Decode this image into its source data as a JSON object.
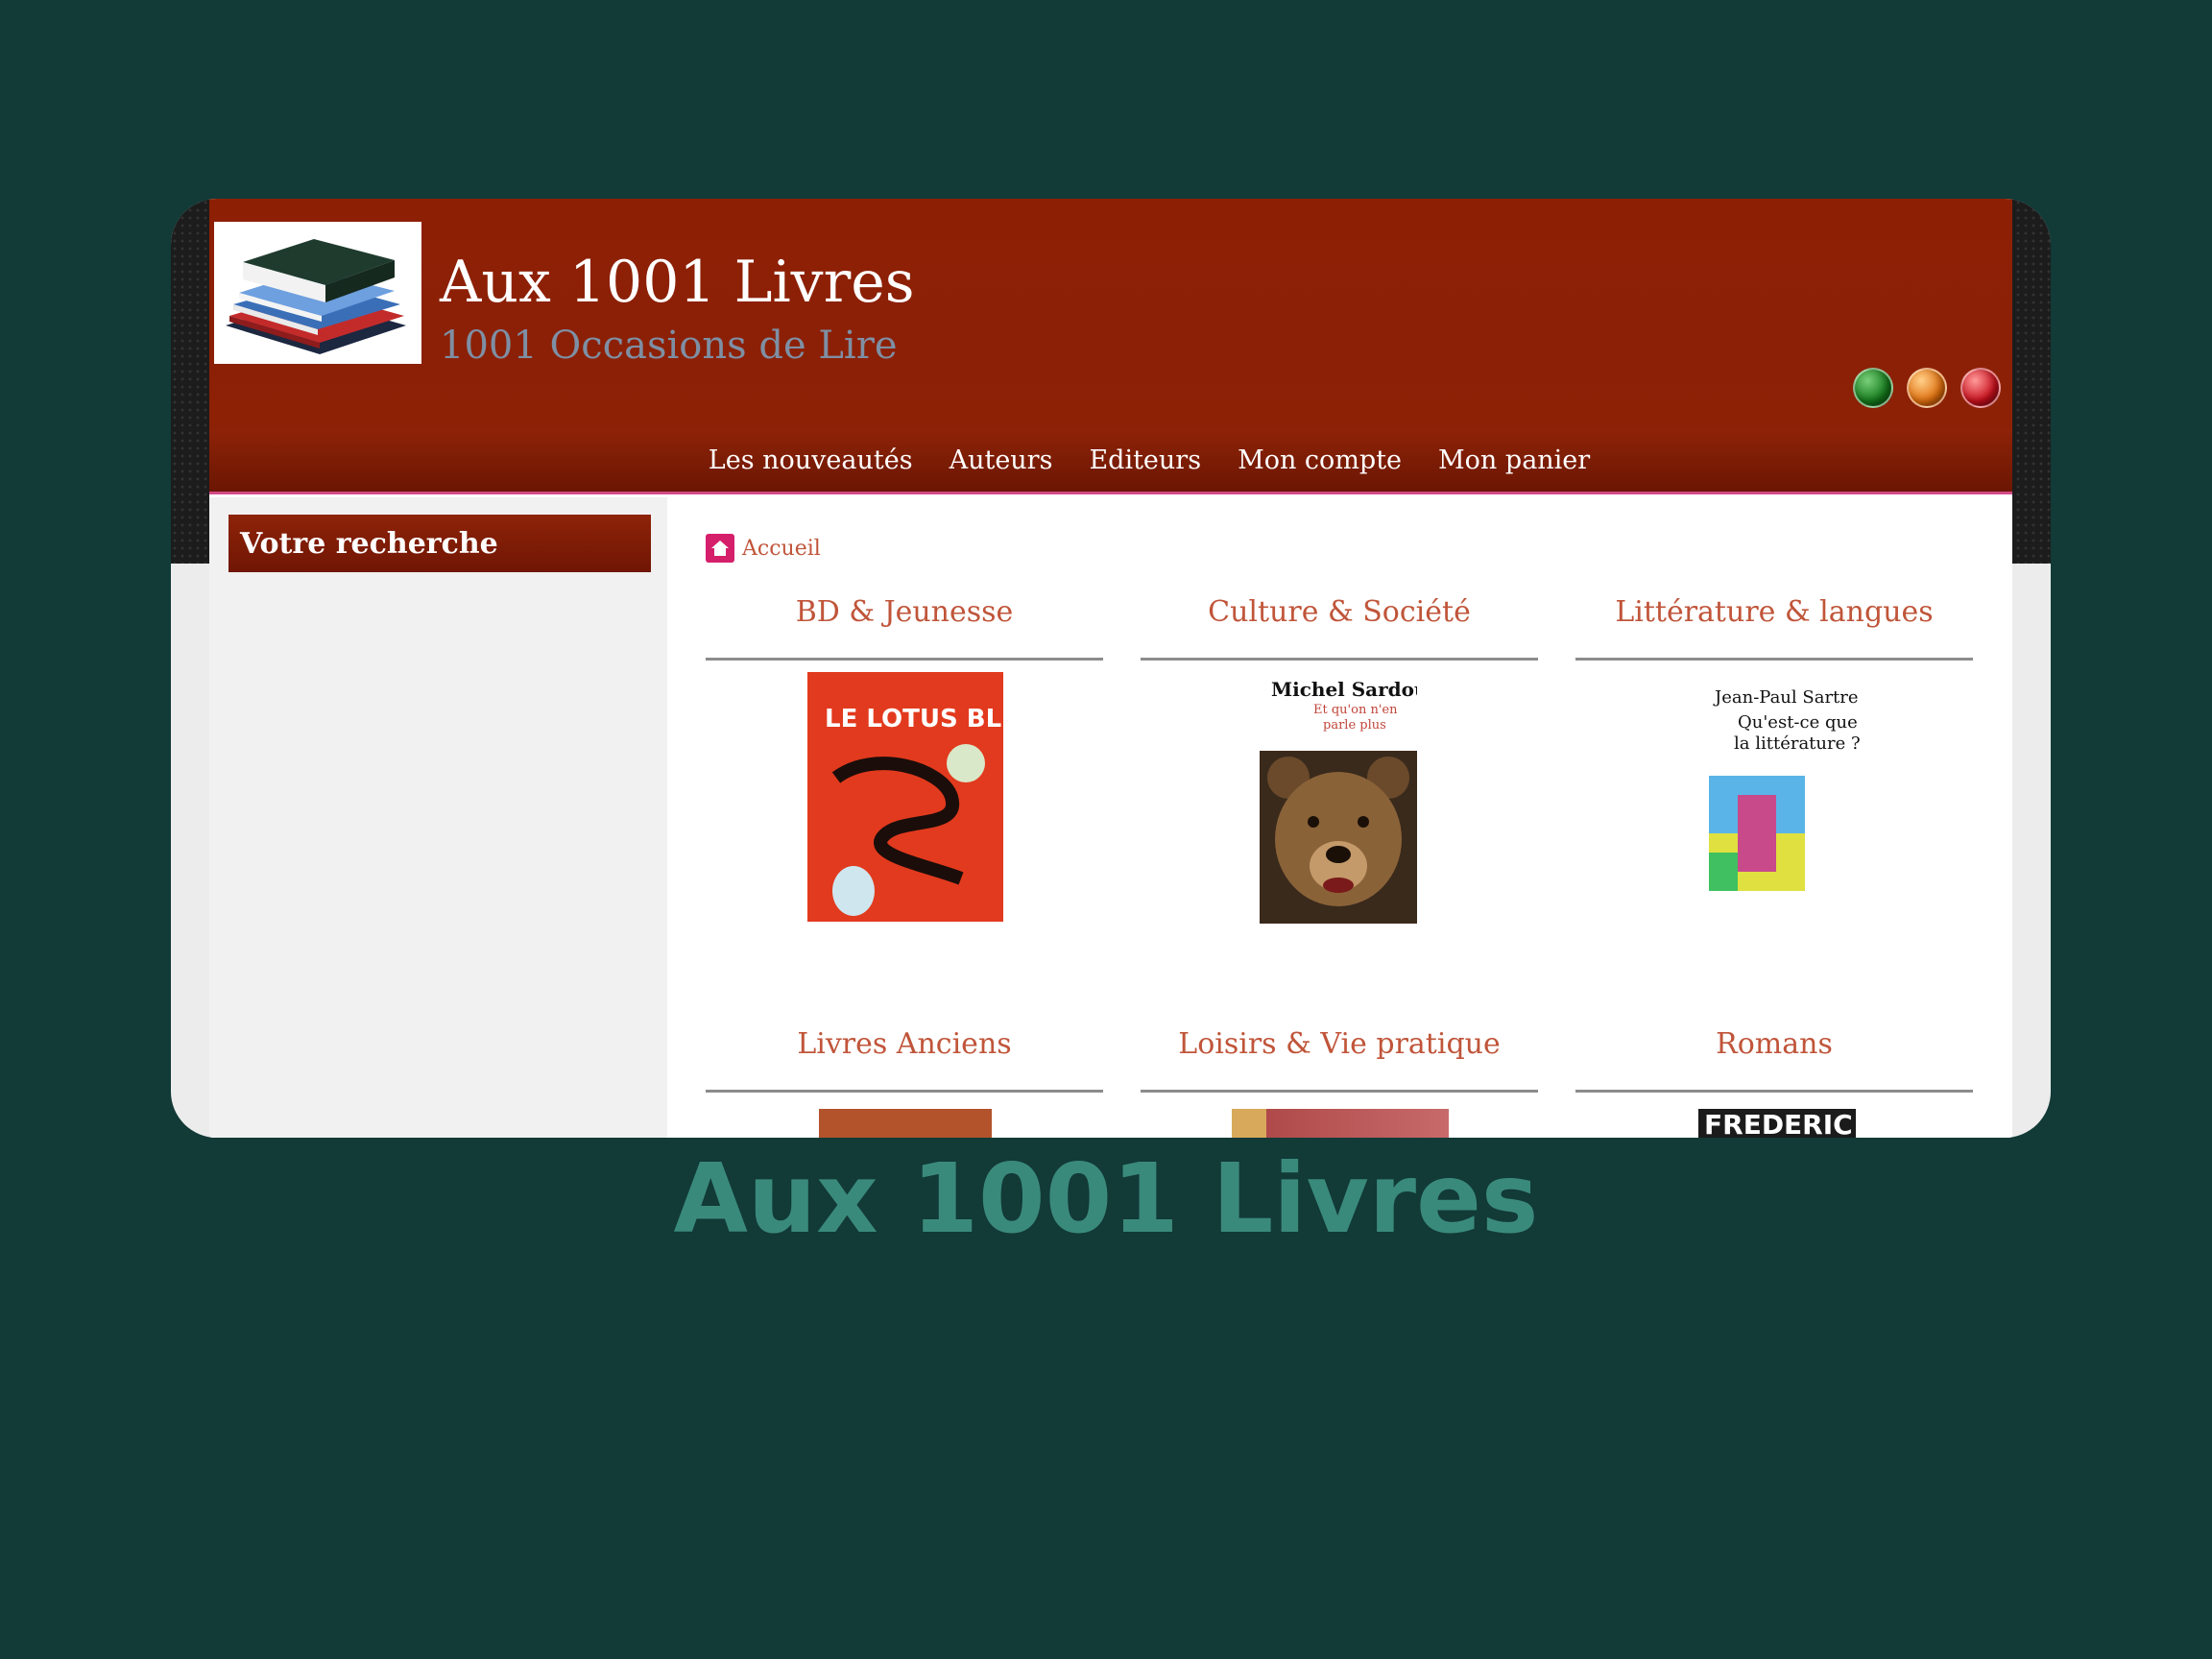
{
  "header": {
    "title": "Aux 1001 Livres",
    "subtitle": "1001 Occasions de Lire"
  },
  "nav": [
    "Les nouveautés",
    "Auteurs",
    "Editeurs",
    "Mon compte",
    "Mon panier"
  ],
  "sidebar": {
    "search_title": "Votre recherche"
  },
  "breadcrumb": {
    "home": "Accueil"
  },
  "categories": [
    {
      "title": "BD & Jeunesse",
      "cover": {
        "lines": [
          "LE LOTUS BLEU"
        ]
      }
    },
    {
      "title": "Culture & Société",
      "cover": {
        "lines": [
          "Michel Sardou",
          "Et qu'on n'en",
          "parle plus"
        ]
      }
    },
    {
      "title": "Littérature & langues",
      "cover": {
        "lines": [
          "Jean-Paul Sartre",
          "Qu'est-ce que",
          "la littérature ?"
        ]
      }
    },
    {
      "title": "Livres Anciens"
    },
    {
      "title": "Loisirs & Vie pratique"
    },
    {
      "title": "Romans",
      "cover": {
        "lines": [
          "FREDERIC"
        ]
      }
    }
  ],
  "caption": "Aux 1001 Livres",
  "colors": {
    "background": "#123a37",
    "header": "#8d1f05",
    "accent": "#d24a86",
    "link": "#c0553a",
    "caption": "#3a8a7c"
  }
}
